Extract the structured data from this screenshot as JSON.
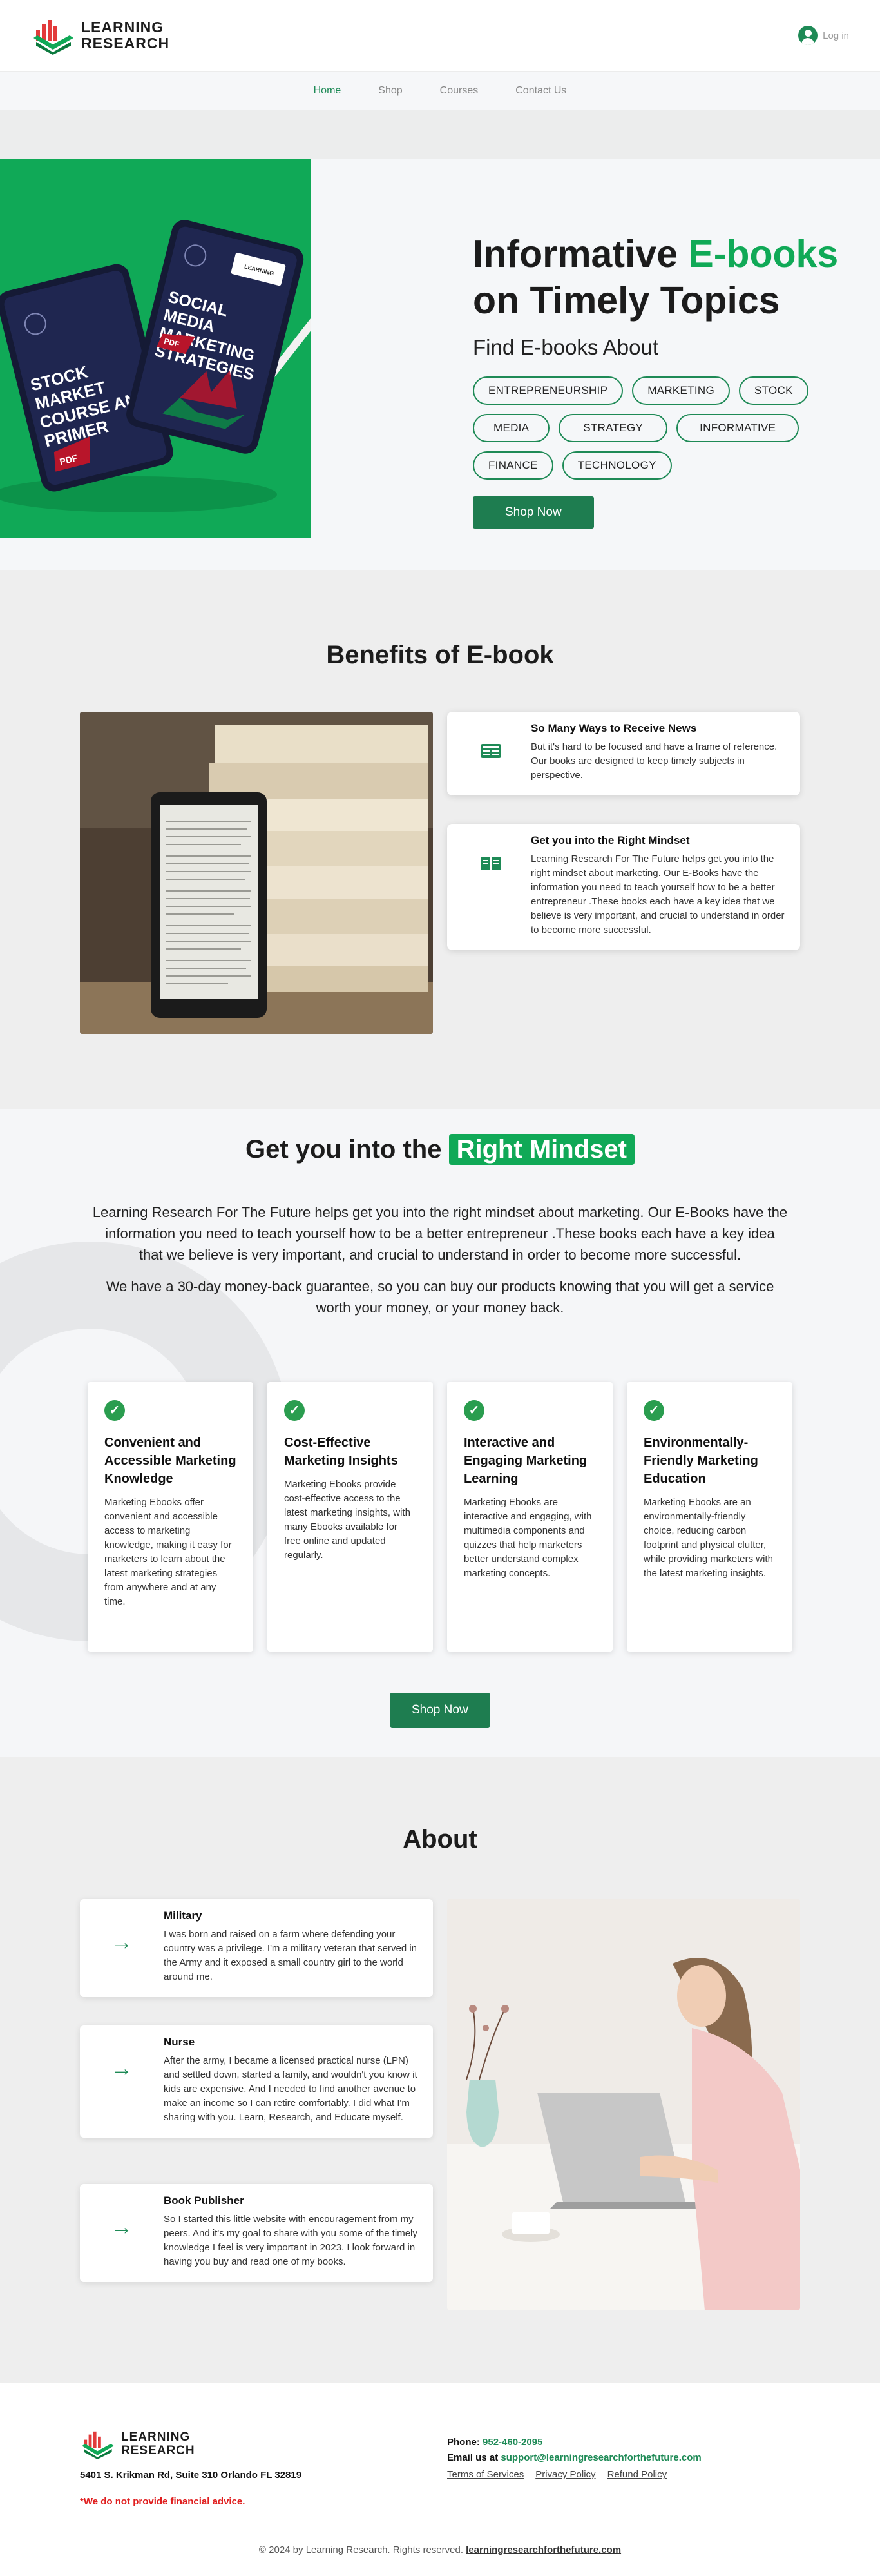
{
  "header": {
    "logo_line1": "LEARNING",
    "logo_line2": "RESEARCH",
    "login_label": "Log in"
  },
  "nav": {
    "items": [
      "Home",
      "Shop",
      "Courses",
      "Contact Us"
    ],
    "active": "Home"
  },
  "hero": {
    "title_part1": "Informative ",
    "title_highlight": "E-books",
    "title_part2": "on Timely Topics",
    "subtitle": "Find E-books About",
    "tags": [
      "ENTREPRENEURSHIP",
      "MARKETING",
      "STOCK",
      "MEDIA",
      "STRATEGY",
      "INFORMATIVE",
      "FINANCE",
      "TECHNOLOGY"
    ],
    "cta": "Shop Now",
    "book1_title": "STOCK MARKET COURSE AND PRIMER",
    "book2_title": "SOCIAL MEDIA MARKETING STRATEGIES",
    "book_badge": "PDF"
  },
  "benefits": {
    "title": "Benefits of E-book",
    "cards": [
      {
        "title": "So Many Ways to Receive News",
        "text": "But it's hard to be focused and have a frame of reference. Our books are designed to keep timely subjects in perspective."
      },
      {
        "title": "Get you into the Right Mindset",
        "text": "Learning Research For The Future helps get you into the right mindset about marketing. Our E-Books have the information you need to teach yourself how to be a better entrepreneur .These books each have a key idea that we believe is very important, and crucial to understand in order to become more successful."
      }
    ]
  },
  "mindset": {
    "title_part1": "Get you into the ",
    "title_highlight": "Right Mindset",
    "paragraph1": "Learning Research For The Future helps get you into the right mindset about marketing. Our E-Books have the information you need to teach yourself how to be a better entrepreneur .These books each have a key idea that we believe is very important, and crucial to understand in order to become more successful.",
    "paragraph2": "We have a 30-day money-back guarantee, so you can buy our products knowing that you will get a service worth your money, or your money back.",
    "features": [
      {
        "title": "Convenient and Accessible Marketing Knowledge",
        "text": "Marketing Ebooks offer convenient and accessible access to marketing knowledge, making it easy for marketers to learn about the latest marketing strategies from anywhere and at any time."
      },
      {
        "title": "Cost-Effective Marketing Insights",
        "text": "Marketing Ebooks provide cost-effective access to the latest marketing insights, with many Ebooks available for free online and updated regularly."
      },
      {
        "title": "Interactive and Engaging Marketing Learning",
        "text": "Marketing Ebooks are interactive and engaging, with multimedia components and quizzes that help marketers better understand complex marketing concepts."
      },
      {
        "title": "Environmentally-Friendly Marketing Education",
        "text": "Marketing Ebooks are an environmentally-friendly choice, reducing carbon footprint and physical clutter, while providing marketers with the latest marketing insights."
      }
    ],
    "cta": "Shop Now"
  },
  "about": {
    "title": "About",
    "cards": [
      {
        "title": "Military",
        "text": "I was born and raised on a farm where defending your country was a privilege. I'm a military veteran that served in the Army and it exposed a small country girl to the world around me."
      },
      {
        "title": "Nurse",
        "text": "After the army, I became a licensed practical nurse (LPN) and settled down, started a family, and wouldn't you know it kids are expensive. And I needed to find another avenue to make an income so I can retire comfortably. I did what I'm sharing with you. Learn, Research, and Educate myself."
      },
      {
        "title": "Book Publisher",
        "text": "So I started this little website with encouragement from my peers. And it's my goal to share with you some of the timely knowledge I feel is very important in 2023. I look forward in having you buy and read one of my books."
      }
    ]
  },
  "footer": {
    "logo_line1": "LEARNING",
    "logo_line2": "RESEARCH",
    "address": "5401 S. Krikman Rd, Suite 310 Orlando FL 32819",
    "warning": "*We do not provide financial advice.",
    "phone_label": "Phone:",
    "phone": "952-460-2095",
    "email_label": "Email us at",
    "email": "support@learningresearchforthefuture.com",
    "links": [
      "Terms of Services",
      "Privacy Policy",
      "Refund Policy"
    ],
    "copyright": "© 2024 by Learning Research. Rights reserved.",
    "site": "learningresearchforthefuture.com"
  },
  "colors": {
    "brand_green": "#10a957",
    "button_green": "#1e7d50",
    "warning_red": "#e01e1e"
  }
}
